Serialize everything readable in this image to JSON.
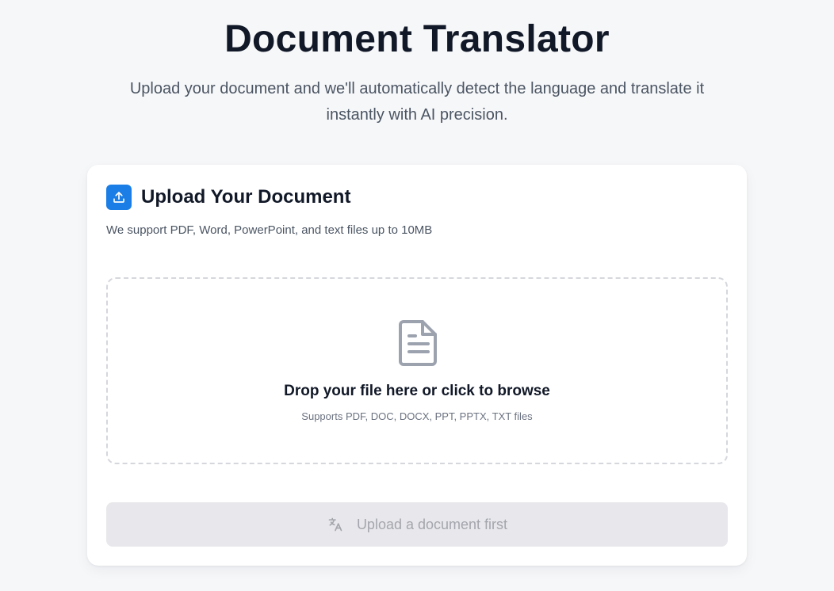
{
  "header": {
    "title": "Document Translator",
    "subtitle_line1": "Upload your document and we'll automatically detect the language and translate it",
    "subtitle_line2": "instantly with AI precision."
  },
  "upload_card": {
    "icon": "upload-icon",
    "title": "Upload Your Document",
    "description": "We support PDF, Word, PowerPoint, and text files up to 10MB",
    "dropzone": {
      "icon": "document-icon",
      "title": "Drop your file here or click to browse",
      "hint": "Supports PDF, DOC, DOCX, PPT, PPTX, TXT files"
    },
    "submit": {
      "icon": "translate-icon",
      "label": "Upload a document first",
      "disabled": true
    }
  },
  "colors": {
    "background": "#f6f7f9",
    "accent": "#1a7ee6",
    "card": "#ffffff",
    "disabled_button": "#e8e8ec",
    "disabled_text": "#a4a6ad"
  }
}
